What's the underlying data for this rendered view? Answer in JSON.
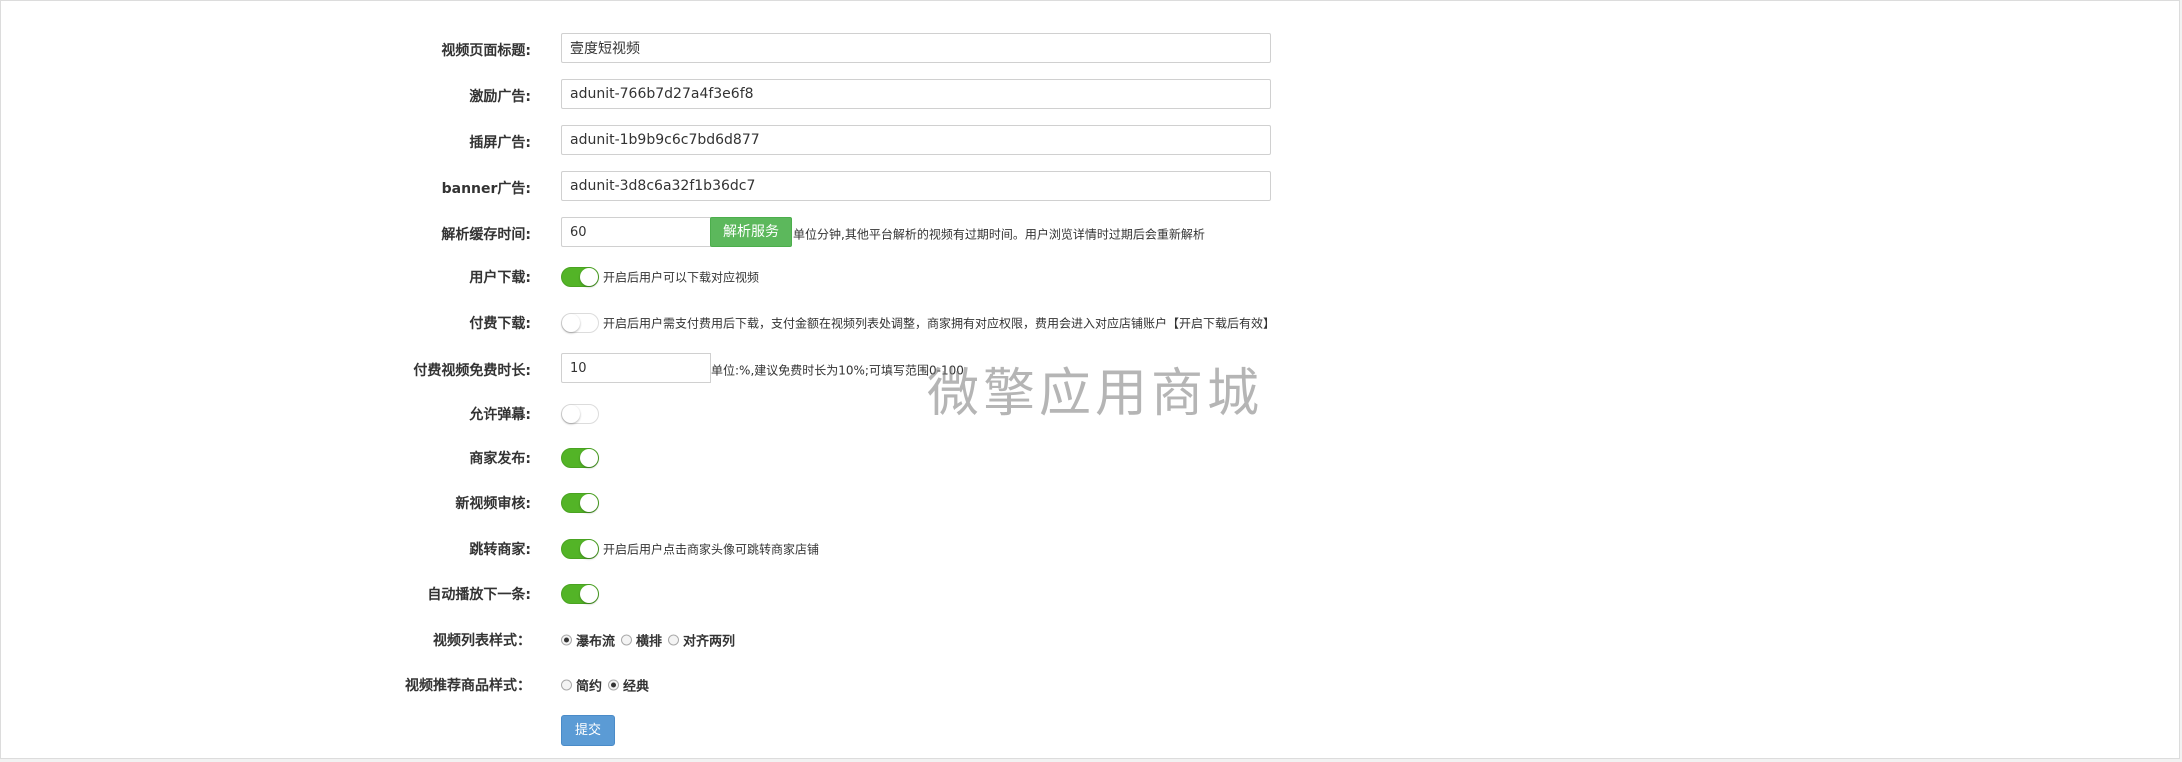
{
  "form": {
    "page_title": {
      "label": "视频页面标题:",
      "value": "壹度短视频"
    },
    "reward_ad": {
      "label": "激励广告:",
      "value": "adunit-766b7d27a4f3e6f8"
    },
    "interstitial_ad": {
      "label": "插屏广告:",
      "value": "adunit-1b9b9c6c7bd6d877"
    },
    "banner_ad": {
      "label": "banner广告:",
      "value": "adunit-3d8c6a32f1b36dc7"
    },
    "cache_time": {
      "label": "解析缓存时间:",
      "value": "60",
      "button": "解析服务",
      "hint": "单位分钟,其他平台解析的视频有过期时间。用户浏览详情时过期后会重新解析"
    },
    "user_download": {
      "label": "用户下载:",
      "on": true,
      "hint": "开启后用户可以下载对应视频"
    },
    "paid_download": {
      "label": "付费下载:",
      "on": false,
      "hint": "开启后用户需支付费用后下载，支付金额在视频列表处调整，商家拥有对应权限，费用会进入对应店铺账户【开启下载后有效】"
    },
    "free_duration": {
      "label": "付费视频免费时长:",
      "value": "10",
      "hint": "单位:%,建议免费时长为10%;可填写范围0-100"
    },
    "allow_danmaku": {
      "label": "允许弹幕:",
      "on": false
    },
    "merchant_publish": {
      "label": "商家发布:",
      "on": true
    },
    "new_video_review": {
      "label": "新视频审核:",
      "on": true
    },
    "jump_merchant": {
      "label": "跳转商家:",
      "on": true,
      "hint": "开启后用户点击商家头像可跳转商家店铺"
    },
    "autoplay_next": {
      "label": "自动播放下一条:",
      "on": true
    },
    "list_style": {
      "label": "视频列表样式：",
      "options": [
        "瀑布流",
        "横排",
        "对齐两列"
      ],
      "selected": "瀑布流"
    },
    "goods_style": {
      "label": "视频推荐商品样式：",
      "options": [
        "简约",
        "经典"
      ],
      "selected": "经典"
    },
    "submit": "提交"
  },
  "watermark": "微擎应用商城",
  "colors": {
    "switch_on": "#53b427",
    "service_button": "#5cb85c",
    "submit_button": "#5b9bd5"
  }
}
